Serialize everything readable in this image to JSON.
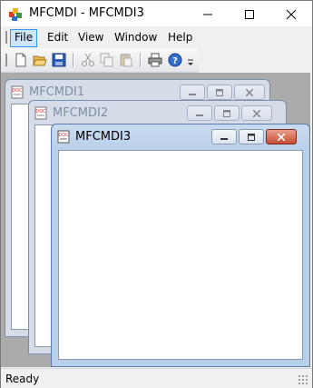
{
  "window": {
    "title": "MFCMDI - MFCMDI3",
    "controls": {
      "minimize": "minimize",
      "maximize": "maximize",
      "close": "close"
    }
  },
  "menu": {
    "items": [
      {
        "label": "File",
        "active": true
      },
      {
        "label": "Edit"
      },
      {
        "label": "View"
      },
      {
        "label": "Window"
      },
      {
        "label": "Help"
      }
    ]
  },
  "toolbar": {
    "buttons": [
      "new-icon",
      "open-icon",
      "save-icon",
      "cut-icon",
      "copy-icon",
      "paste-icon",
      "print-icon",
      "help-icon",
      "overflow-chevron-icon"
    ]
  },
  "mdi_children": [
    {
      "title": "MFCMDI1",
      "state": "inactive"
    },
    {
      "title": "MFCMDI2",
      "state": "inactive"
    },
    {
      "title": "MFCMDI3",
      "state": "active"
    }
  ],
  "status": {
    "text": "Ready"
  },
  "colors": {
    "accent": "#3399ff",
    "menu_highlight": "#cce4f7",
    "mdi_background": "#ababab",
    "active_close": "#c74b33"
  }
}
